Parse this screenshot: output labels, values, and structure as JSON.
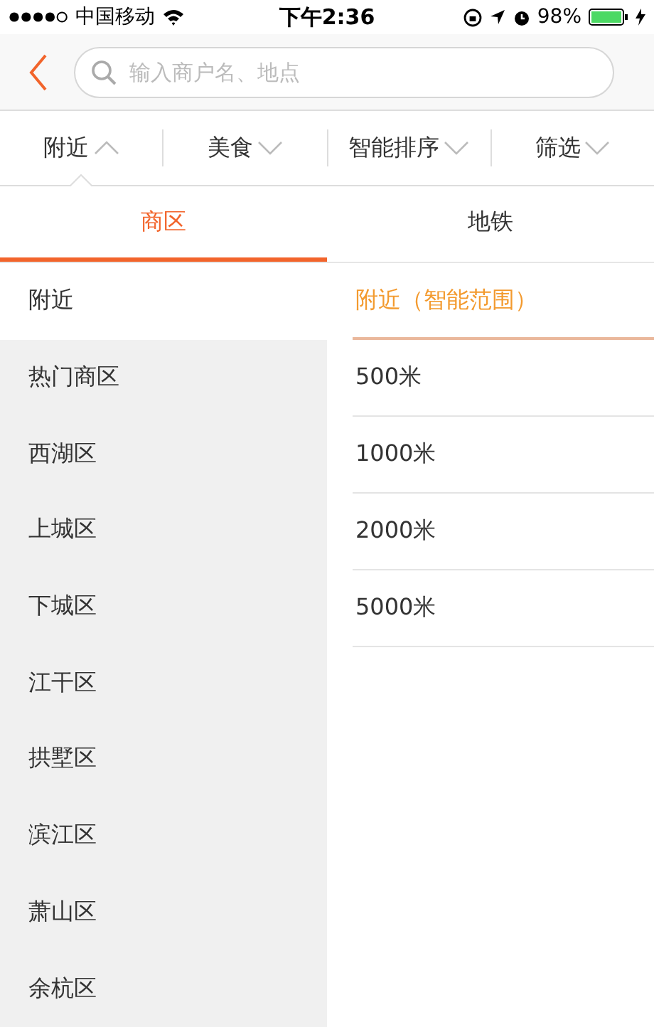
{
  "status_bar": {
    "carrier": "中国移动",
    "time": "下午2:36",
    "battery": "98%"
  },
  "nav_bar": {
    "search": {
      "placeholder": "输入商户名、地点"
    }
  },
  "filters": [
    {
      "label": "附近",
      "expanded": true
    },
    {
      "label": "美食",
      "expanded": false
    },
    {
      "label": "智能排序",
      "expanded": false
    },
    {
      "label": "筛选",
      "expanded": false
    }
  ],
  "tabs": [
    {
      "label": "商区",
      "selected": true
    },
    {
      "label": "地铁",
      "selected": false
    }
  ],
  "districts": [
    {
      "label": "附近",
      "selected": true
    },
    {
      "label": "热门商区",
      "selected": false
    },
    {
      "label": "西湖区",
      "selected": false
    },
    {
      "label": "上城区",
      "selected": false
    },
    {
      "label": "下城区",
      "selected": false
    },
    {
      "label": "江干区",
      "selected": false
    },
    {
      "label": "拱墅区",
      "selected": false
    },
    {
      "label": "滨江区",
      "selected": false
    },
    {
      "label": "萧山区",
      "selected": false
    },
    {
      "label": "余杭区",
      "selected": false
    }
  ],
  "ranges": [
    {
      "label": "附近（智能范围）",
      "selected": true
    },
    {
      "label": "500米",
      "selected": false
    },
    {
      "label": "1000米",
      "selected": false
    },
    {
      "label": "2000米",
      "selected": false
    },
    {
      "label": "5000米",
      "selected": false
    }
  ]
}
